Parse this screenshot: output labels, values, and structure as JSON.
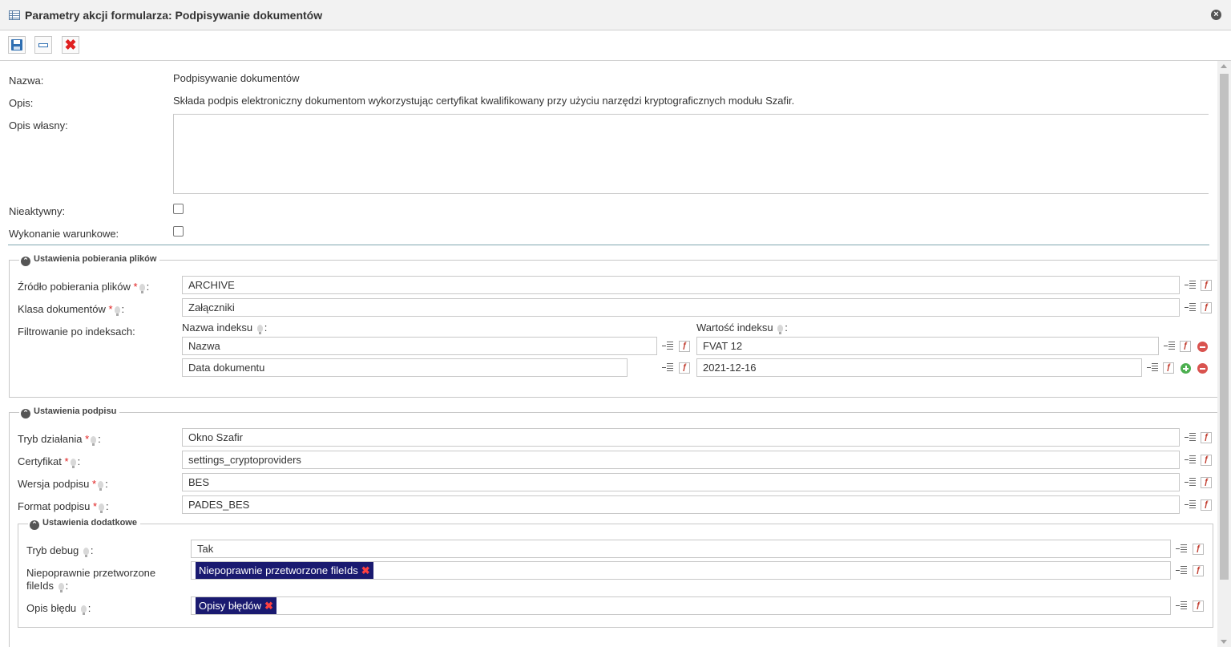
{
  "window": {
    "title": "Parametry akcji formularza: Podpisywanie dokumentów",
    "icon": "table-icon",
    "close_icon": "close-icon"
  },
  "toolbar": {
    "buttons": [
      {
        "name": "save",
        "icon": "floppy-icon"
      },
      {
        "name": "execute",
        "icon": "field-icon"
      },
      {
        "name": "delete",
        "icon": "red-x-icon",
        "glyph": "✖"
      }
    ]
  },
  "general": {
    "name_label": "Nazwa:",
    "name_value": "Podpisywanie dokumentów",
    "desc_label": "Opis:",
    "desc_value": "Składa podpis elektroniczny dokumentom wykorzystując certyfikat kwalifikowany przy użyciu narzędzi kryptograficznych modułu Szafir.",
    "custom_desc_label": "Opis własny:",
    "custom_desc_value": "",
    "inactive_label": "Nieaktywny:",
    "inactive_checked": false,
    "conditional_label": "Wykonanie warunkowe:",
    "conditional_checked": false
  },
  "files_section": {
    "legend": "Ustawienia pobierania plików",
    "source_label": "Źródło pobierania plików",
    "source_value": "ARCHIVE",
    "class_label": "Klasa dokumentów",
    "class_value": "Załączniki",
    "filter_label": "Filtrowanie po indeksach:",
    "index_name_header": "Nazwa indeksu",
    "index_value_header": "Wartość indeksu",
    "filters": [
      {
        "name": "Nazwa",
        "value": "FVAT 12"
      },
      {
        "name": "Data dokumentu",
        "value": "2021-12-16"
      }
    ]
  },
  "signature_section": {
    "legend": "Ustawienia podpisu",
    "mode_label": "Tryb działania",
    "mode_value": "Okno Szafir",
    "cert_label": "Certyfikat",
    "cert_value": "settings_cryptoproviders",
    "version_label": "Wersja podpisu",
    "version_value": "BES",
    "format_label": "Format podpisu",
    "format_value": "PADES_BES"
  },
  "additional_section": {
    "legend": "Ustawienia dodatkowe",
    "debug_label": "Tryb debug",
    "debug_value": "Tak",
    "failed_label_line1": "Niepoprawnie przetworzone",
    "failed_label_line2": "fileIds",
    "failed_tag": "Niepoprawnie przetworzone fileIds",
    "error_label": "Opis błędu",
    "error_tag": "Opisy błędów"
  },
  "common": {
    "required_mark": "*",
    "colon": ":",
    "fx_glyph": "ƒ",
    "tag_remove_glyph": "✖",
    "collapse_glyph": "⌃"
  }
}
